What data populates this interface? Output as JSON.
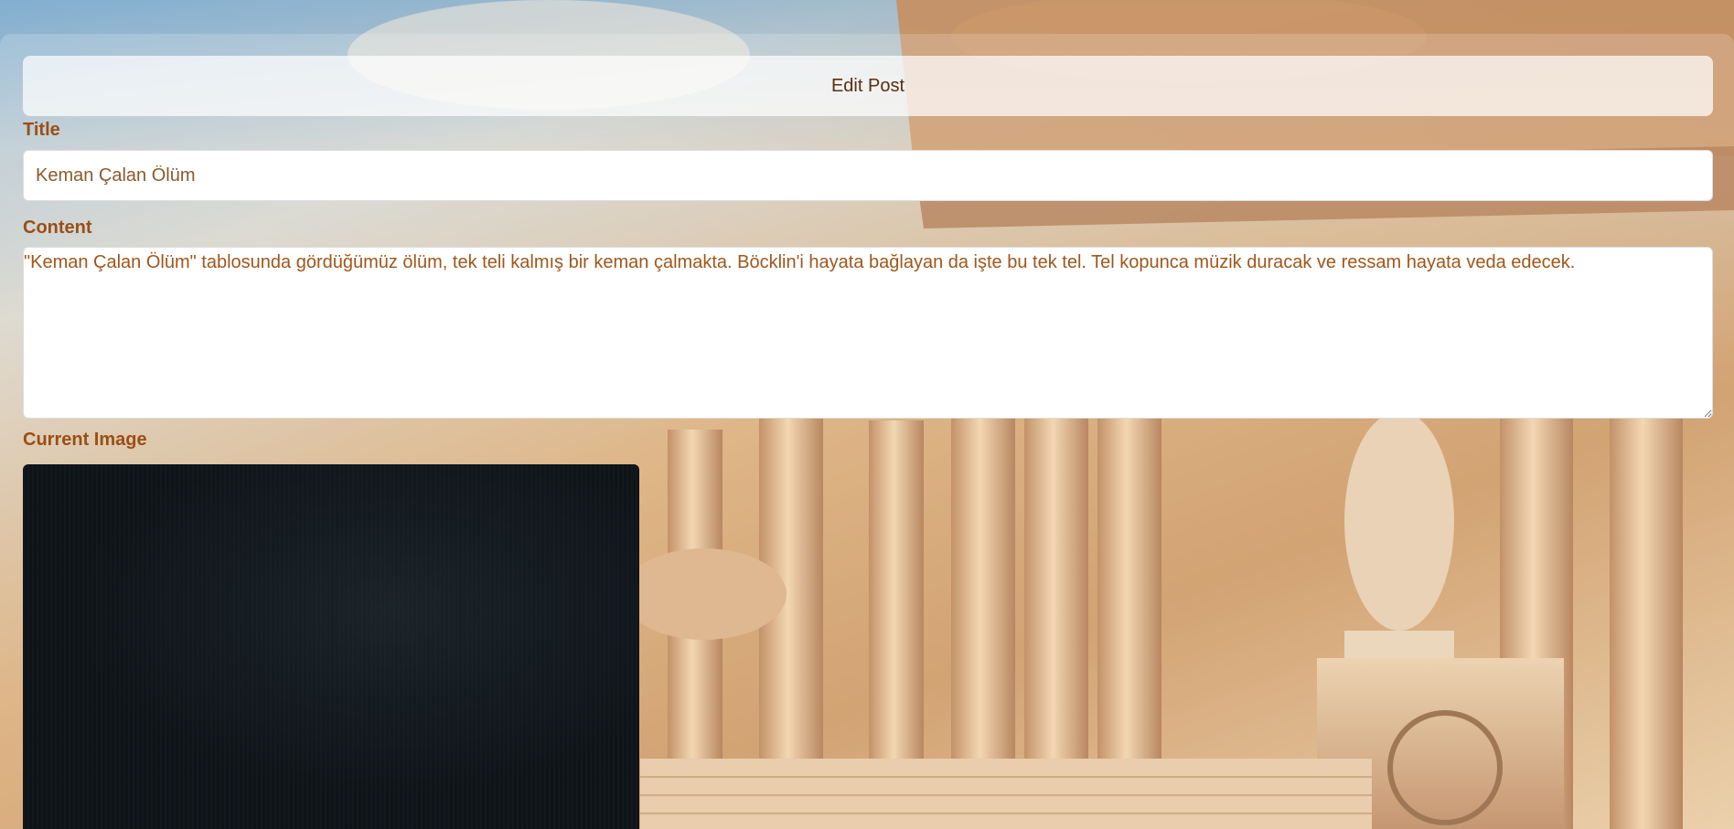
{
  "header": {
    "title": "Edit Post"
  },
  "form": {
    "title_label": "Title",
    "title_value": "Keman Çalan Ölüm",
    "content_label": "Content",
    "content_value": "\"Keman Çalan Ölüm\" tablosunda gördüğümüz ölüm, tek teli kalmış bir keman çalmakta. Böcklin'i hayata bağlayan da işte bu tek tel. Tel kopunca müzik duracak ve ressam hayata veda edecek.",
    "image_label": "Current Image"
  },
  "colors": {
    "label": "#9a4f15",
    "header_text": "#5a2e10",
    "input_text": "#8a5a2c",
    "content_text": "#a0561a"
  }
}
